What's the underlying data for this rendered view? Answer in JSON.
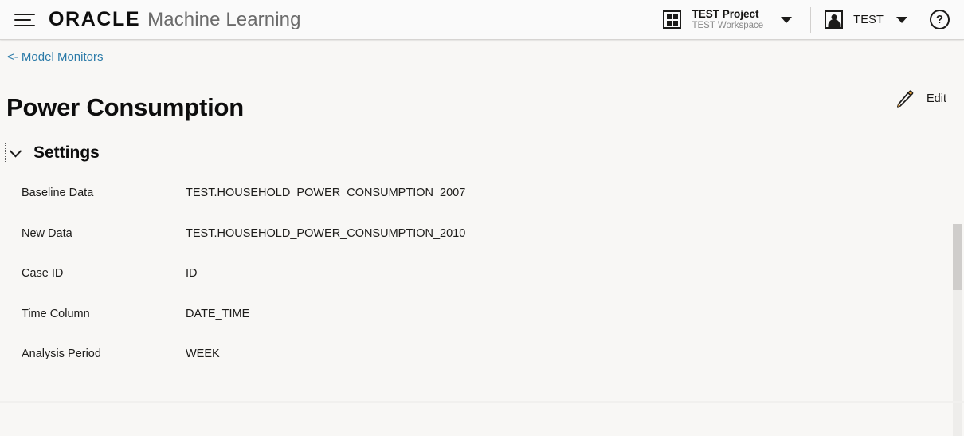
{
  "header": {
    "menu_icon": "hamburger-menu-icon",
    "brand_primary": "ORACLE",
    "brand_secondary": "Machine Learning",
    "project": {
      "icon": "grid-apps-icon",
      "name": "TEST Project",
      "workspace": "TEST Workspace",
      "caret_icon": "caret-down-icon"
    },
    "user": {
      "icon": "user-avatar-icon",
      "name": "TEST",
      "caret_icon": "caret-down-icon"
    },
    "help": {
      "icon": "help-question-icon",
      "glyph": "?"
    }
  },
  "page": {
    "breadcrumb": "<- Model Monitors",
    "title": "Power Consumption",
    "edit": {
      "icon": "pencil-edit-icon",
      "label": "Edit"
    }
  },
  "settings": {
    "collapse_icon": "chevron-down-icon",
    "title": "Settings",
    "rows": [
      {
        "label": "Baseline Data",
        "value": "TEST.HOUSEHOLD_POWER_CONSUMPTION_2007"
      },
      {
        "label": "New Data",
        "value": "TEST.HOUSEHOLD_POWER_CONSUMPTION_2010"
      },
      {
        "label": "Case ID",
        "value": "ID"
      },
      {
        "label": "Time Column",
        "value": "DATE_TIME"
      },
      {
        "label": "Analysis Period",
        "value": "WEEK"
      }
    ]
  },
  "colors": {
    "link": "#2a7aa8",
    "header_bg": "#fafafa",
    "page_bg": "#f8f7f5",
    "text": "#161513",
    "muted": "#8a8a8a",
    "accent_pencil": "#e8a33d"
  }
}
